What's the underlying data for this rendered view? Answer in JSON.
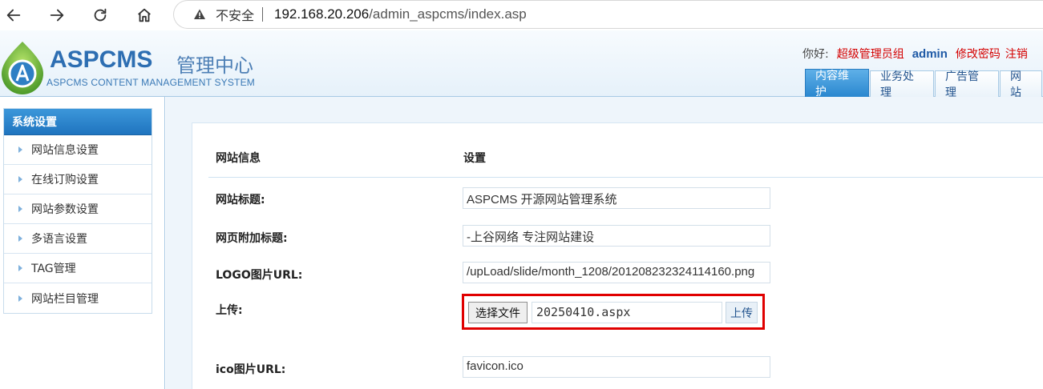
{
  "browser": {
    "insecure_label": "不安全",
    "url_host": "192.168.20.206",
    "url_path": "/admin_aspcms/index.asp"
  },
  "header": {
    "logo_name": "ASPCMS",
    "logo_cn": "管理中心",
    "logo_subtitle": "ASPCMS CONTENT MANAGEMENT SYSTEM",
    "greeting": "你好:",
    "role": "超级管理员组",
    "username": "admin",
    "change_password": "修改密码",
    "logout": "注销",
    "tabs": [
      {
        "label": "内容维护",
        "active": true
      },
      {
        "label": "业务处理",
        "active": false
      },
      {
        "label": "广告管理",
        "active": false
      },
      {
        "label": "网站",
        "active": false
      }
    ]
  },
  "sidebar": {
    "title": "系统设置",
    "items": [
      {
        "label": "网站信息设置"
      },
      {
        "label": "在线订购设置"
      },
      {
        "label": "网站参数设置"
      },
      {
        "label": "多语言设置"
      },
      {
        "label": "TAG管理"
      },
      {
        "label": "网站栏目管理"
      }
    ]
  },
  "form": {
    "col1_header": "网站信息",
    "col2_header": "设置",
    "rows": [
      {
        "label": "网站标题:",
        "value": "ASPCMS 开源网站管理系统"
      },
      {
        "label": "网页附加标题:",
        "value": "-上谷网络 专注网站建设"
      },
      {
        "label": "LOGO图片URL:",
        "value": "/upLoad/slide/month_1208/201208232324114160.png"
      },
      {
        "label": "上传:"
      },
      {
        "label": "ico图片URL:",
        "value": "favicon.ico"
      }
    ],
    "upload": {
      "choose_file": "选择文件",
      "file_name": "20250410.aspx",
      "upload_button": "上传"
    }
  },
  "colors": {
    "accent": "#2a87cf",
    "highlight": "#e00000",
    "danger_text": "#d40000"
  }
}
